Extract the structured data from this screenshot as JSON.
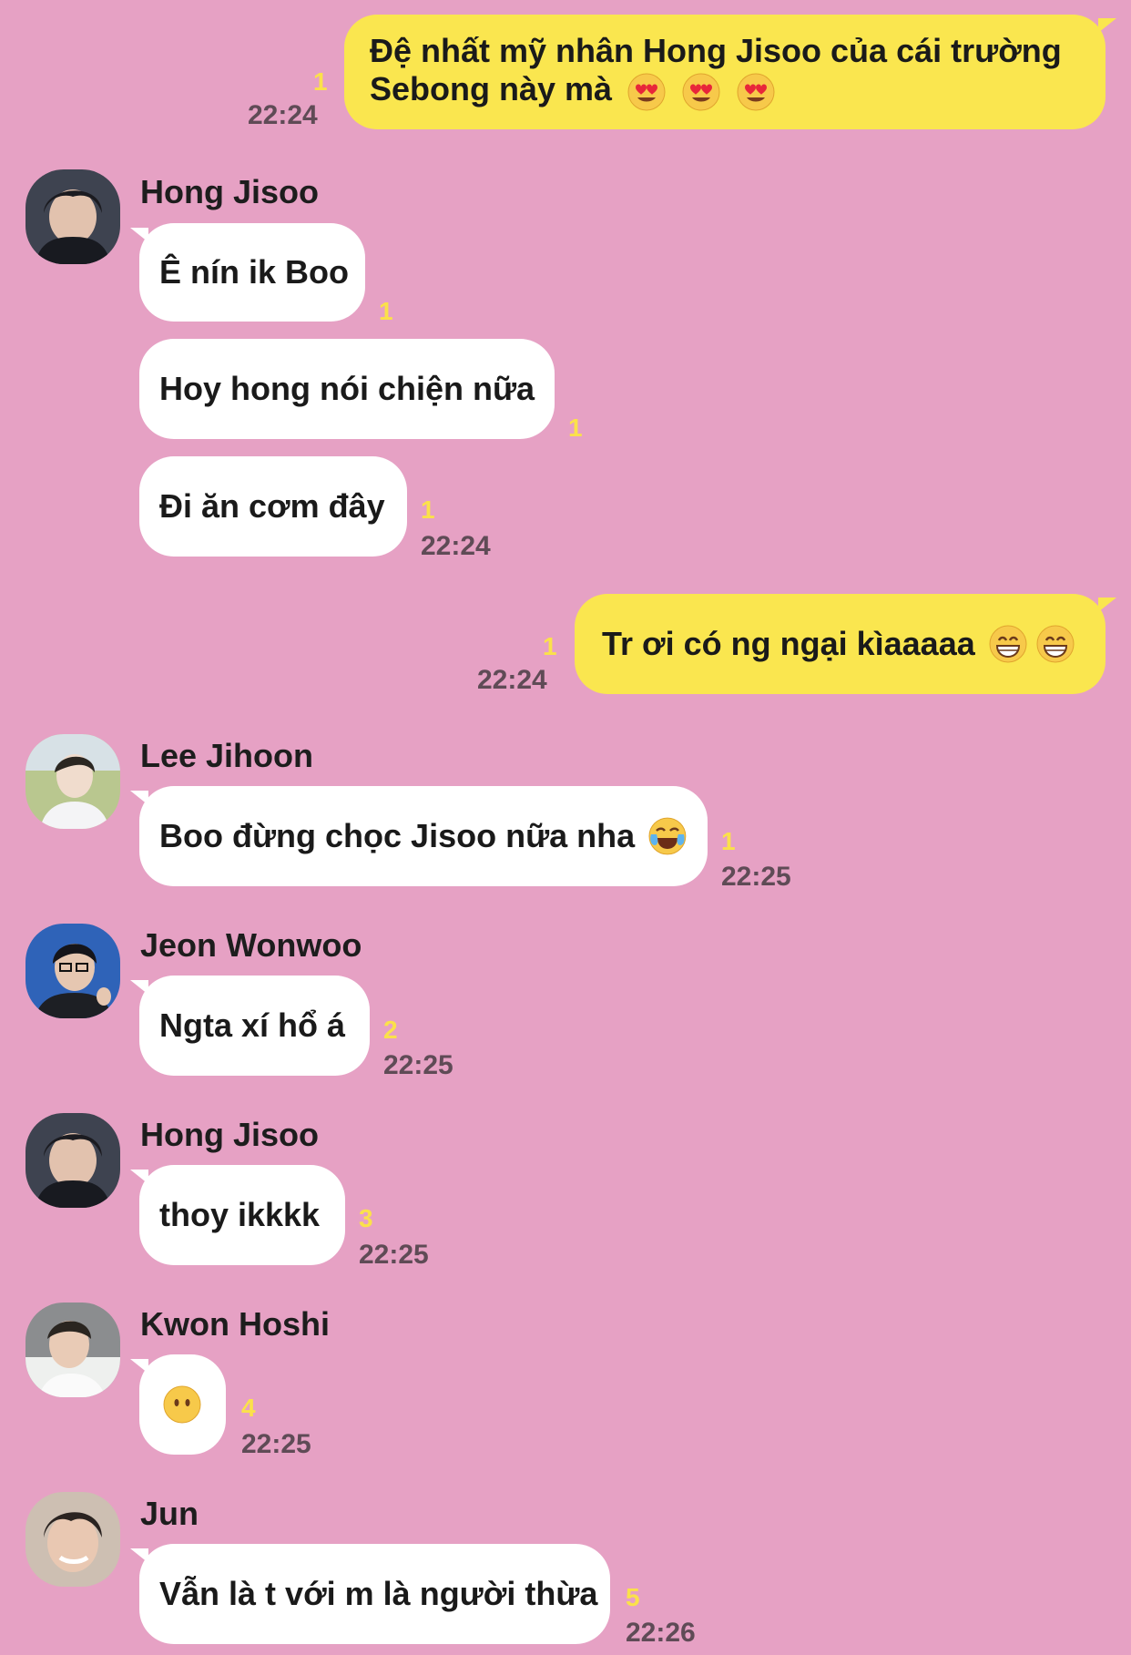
{
  "messages": [
    {
      "id": "m1",
      "side": "out",
      "text_line1": "Đệ nhất mỹ nhân Hong Jisoo của cái trường",
      "text_line2": "Sebong này mà",
      "emojis": [
        "heart-eyes-icon",
        "heart-eyes-icon",
        "heart-eyes-icon"
      ],
      "unread": "1",
      "time": "22:24"
    },
    {
      "id": "m2",
      "side": "in",
      "sender": "Hong Jisoo",
      "text": "Ê nín ik Boo",
      "unread": "1"
    },
    {
      "id": "m3",
      "side": "in",
      "text": "Hoy hong nói chiện nữa",
      "unread": "1"
    },
    {
      "id": "m4",
      "side": "in",
      "text": "Đi ăn cơm đây",
      "unread": "1",
      "time": "22:24"
    },
    {
      "id": "m5",
      "side": "out",
      "text": "Tr ơi có ng ngại kìaaaaa",
      "emojis": [
        "grin-icon",
        "grin-icon"
      ],
      "unread": "1",
      "time": "22:24"
    },
    {
      "id": "m6",
      "side": "in",
      "sender": "Lee Jihoon",
      "text": "Boo đừng chọc Jisoo nữa nha",
      "emojis": [
        "tears-of-joy-icon"
      ],
      "unread": "1",
      "time": "22:25"
    },
    {
      "id": "m7",
      "side": "in",
      "sender": "Jeon Wonwoo",
      "text": "Ngta xí hổ á",
      "unread": "2",
      "time": "22:25"
    },
    {
      "id": "m8",
      "side": "in",
      "sender": "Hong Jisoo",
      "text": "thoy ikkkk",
      "unread": "3",
      "time": "22:25"
    },
    {
      "id": "m9",
      "side": "in",
      "sender": "Kwon Hoshi",
      "text": "",
      "emojis": [
        "no-mouth-face-icon"
      ],
      "unread": "4",
      "time": "22:25"
    },
    {
      "id": "m10",
      "side": "in",
      "sender": "Jun",
      "text": "Vẫn là t với m là người thừa",
      "unread": "5",
      "time": "22:26"
    }
  ],
  "colors": {
    "background": "#e6a1c4",
    "outgoing_bubble": "#fae64f",
    "incoming_bubble": "#ffffff",
    "unread_count": "#fbe14a",
    "timestamp": "#5f4b56"
  }
}
